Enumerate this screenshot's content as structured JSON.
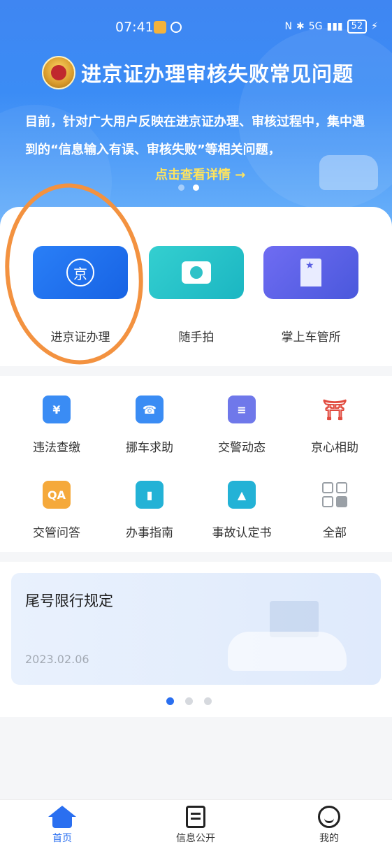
{
  "status_bar": {
    "time": "07:41",
    "network": "5G",
    "battery": "52"
  },
  "banner": {
    "title": "进京证办理审核失败常见问题",
    "description": "目前，针对广大用户反映在进京证办理、审核过程中，集中遇到的“信息输入有误、审核失败”等相关问题，",
    "link": "点击查看详情 →",
    "dots_total": 2,
    "dots_active": 2
  },
  "main_actions": [
    {
      "label": "进京证办理",
      "icon": "jing-badge-icon",
      "glyph": "京"
    },
    {
      "label": "随手拍",
      "icon": "camera-icon"
    },
    {
      "label": "掌上车管所",
      "icon": "building-icon"
    }
  ],
  "services": [
    {
      "label": "违法查缴",
      "icon": "fine-payment-icon"
    },
    {
      "label": "挪车求助",
      "icon": "car-phone-icon"
    },
    {
      "label": "交警动态",
      "icon": "news-icon"
    },
    {
      "label": "京心相助",
      "icon": "tiananmen-icon"
    },
    {
      "label": "交管问答",
      "icon": "qa-icon"
    },
    {
      "label": "办事指南",
      "icon": "bookmark-icon"
    },
    {
      "label": "事故认定书",
      "icon": "accident-report-icon"
    },
    {
      "label": "全部",
      "icon": "all-grid-icon"
    }
  ],
  "news_card": {
    "title": "尾号限行规定",
    "date": "2023.02.06",
    "dots_total": 3,
    "dots_active": 1
  },
  "tabbar": [
    {
      "label": "首页",
      "icon": "home-icon",
      "active": true
    },
    {
      "label": "信息公开",
      "icon": "document-icon",
      "active": false
    },
    {
      "label": "我的",
      "icon": "smiley-icon",
      "active": false
    }
  ],
  "colors": {
    "primary": "#2a6ff0",
    "banner": "#3b8cf5",
    "highlight": "#ffe45e",
    "annotation": "#f39240"
  }
}
